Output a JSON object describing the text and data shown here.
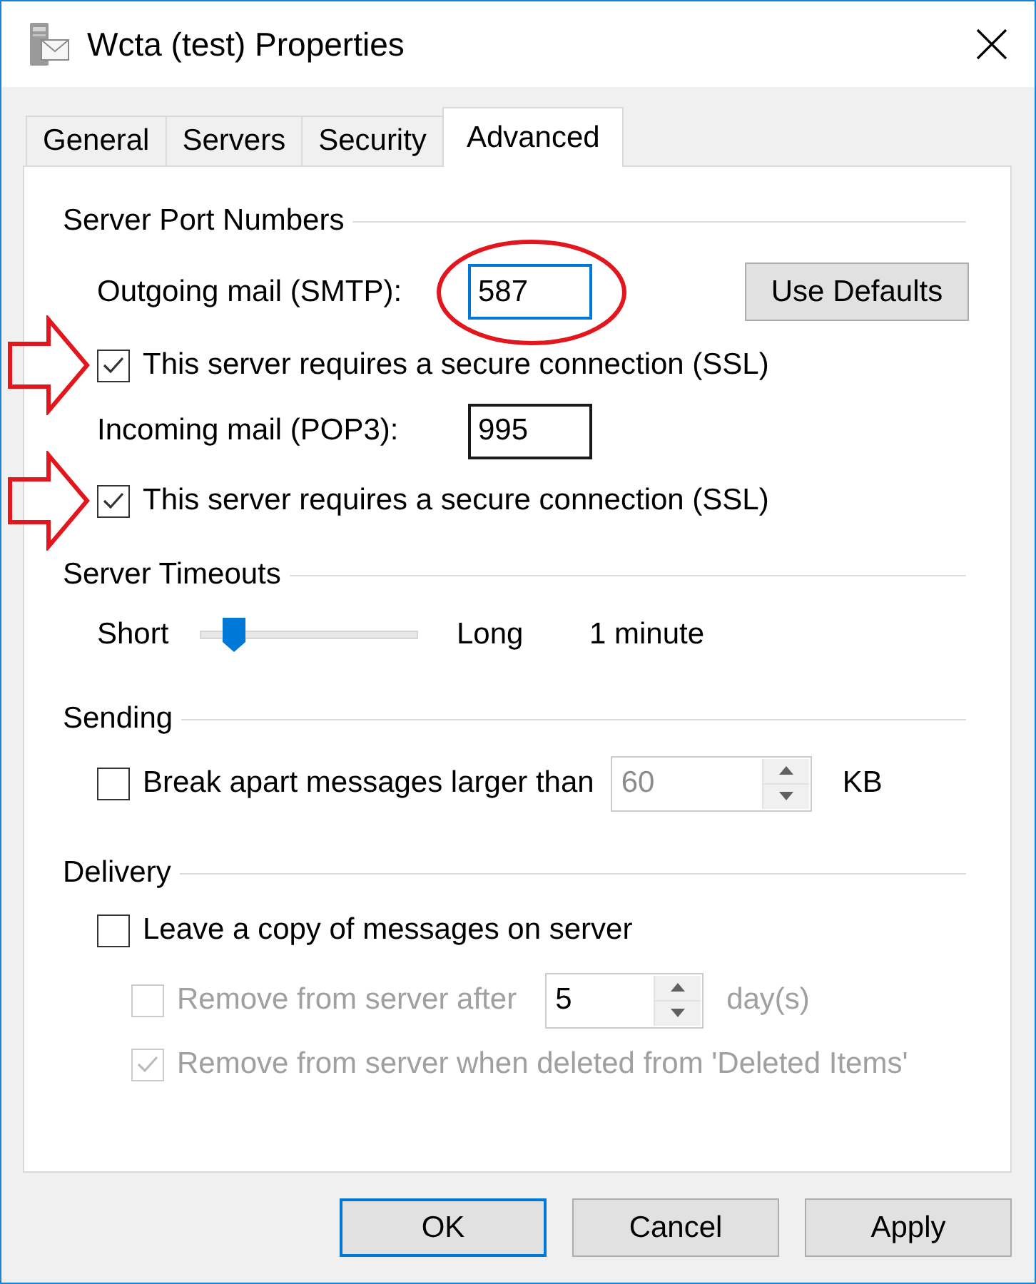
{
  "window": {
    "title": "Wcta (test) Properties"
  },
  "tabs": [
    {
      "label": "General",
      "selected": false
    },
    {
      "label": "Servers",
      "selected": false
    },
    {
      "label": "Security",
      "selected": false
    },
    {
      "label": "Advanced",
      "selected": true
    }
  ],
  "server_port_numbers": {
    "title": "Server Port Numbers",
    "outgoing": {
      "label": "Outgoing mail (SMTP):",
      "value": "587",
      "focused": true,
      "circled": true
    },
    "use_defaults_button": "Use Defaults",
    "outgoing_ssl": {
      "label": "This server requires a secure connection (SSL)",
      "checked": true,
      "arrow": true
    },
    "incoming": {
      "label": "Incoming mail (POP3):",
      "value": "995",
      "focused": false
    },
    "incoming_ssl": {
      "label": "This server requires a secure connection (SSL)",
      "checked": true,
      "arrow": true
    }
  },
  "server_timeouts": {
    "title": "Server Timeouts",
    "min_label": "Short",
    "max_label": "Long",
    "level": 0.12,
    "reading": "1 minute"
  },
  "sending": {
    "title": "Sending",
    "break_apart": {
      "label": "Break apart messages larger than",
      "checked": false
    },
    "size_field": {
      "value": "60",
      "disabled": true
    },
    "unit": "KB"
  },
  "delivery": {
    "title": "Delivery",
    "leave_copy": {
      "label": "Leave a copy of messages on server",
      "checked": false
    },
    "remove_after": {
      "label": "Remove from server after",
      "checked": false,
      "disabled": true
    },
    "days_field": {
      "value": "5"
    },
    "unit": "day(s)",
    "remove_when_deleted": {
      "label": "Remove from server when deleted from 'Deleted Items'",
      "checked": true,
      "disabled": true
    }
  },
  "buttons": [
    {
      "label": "OK",
      "default": true
    },
    {
      "label": "Cancel",
      "default": false
    },
    {
      "label": "Apply",
      "default": false
    }
  ]
}
